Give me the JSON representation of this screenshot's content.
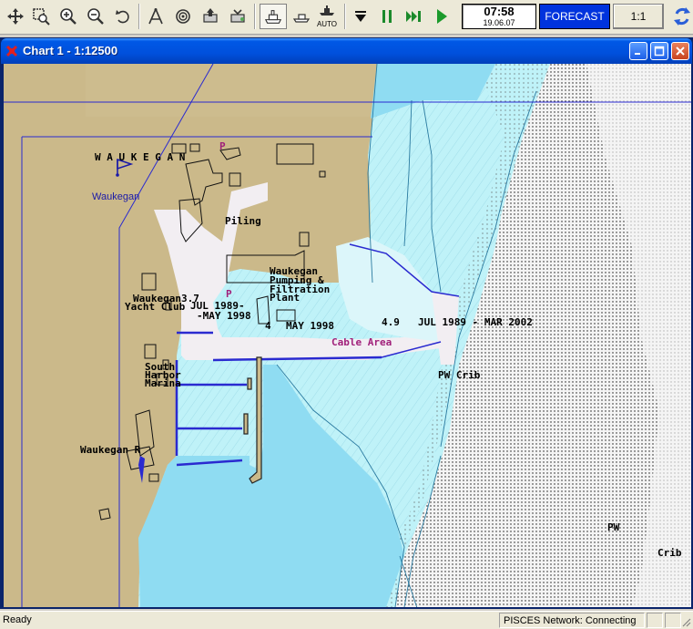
{
  "toolbar": {
    "icons": [
      "pan-icon",
      "zoom-rect-icon",
      "zoom-in-icon",
      "zoom-out-icon",
      "undo-icon",
      "measure-icon",
      "target-icon",
      "print-icon",
      "print-setup-icon",
      "ship-chart-icon",
      "ship-icon",
      "ship-auto-icon",
      "stop-icon",
      "pause-icon",
      "fast-forward-icon",
      "play-icon",
      "refresh-icon"
    ],
    "auto_label": "AUTO",
    "clock_time": "07:58",
    "clock_date": "19.06.07",
    "forecast_label": "FORECAST",
    "scale_label": "1:1"
  },
  "window": {
    "title": "Chart 1 - 1:12500"
  },
  "chart": {
    "labels": {
      "town": "W A U K E G A N",
      "town_blue": "Waukegan",
      "piling": "Piling",
      "pumping1": "Waukegan",
      "pumping2": "Pumping &",
      "pumping3": "Filtration",
      "pumping4": "Plant",
      "yacht1": "Waukegan3.7",
      "yacht2": "Yacht Club",
      "jul1989": "JUL 1989-",
      "may1998a": "-MAY 1998",
      "depth4": "4",
      "may1998b": "MAY 1998",
      "depth49": "4.9",
      "jul_mar": "JUL 1989 - MAR 2002",
      "cable": "Cable Area",
      "south1": "South",
      "south2": "Harbor",
      "south3": "Marina",
      "pw_crib": "PW  Crib",
      "river": "Waukegan R",
      "pw": "PW",
      "crib": "Crib",
      "p_marker": "P",
      "p_marker2": "P"
    },
    "colors": {
      "land": "#cbb98a",
      "shallow": "#8fdcf2",
      "water": "#bff2f8",
      "deep": "#ffffff",
      "drying": "#f2eef2",
      "dotted": "#f4f4f4",
      "line": "#2a2ad0"
    }
  },
  "status": {
    "left": "Ready",
    "network": "PISCES Network: Connecting"
  }
}
